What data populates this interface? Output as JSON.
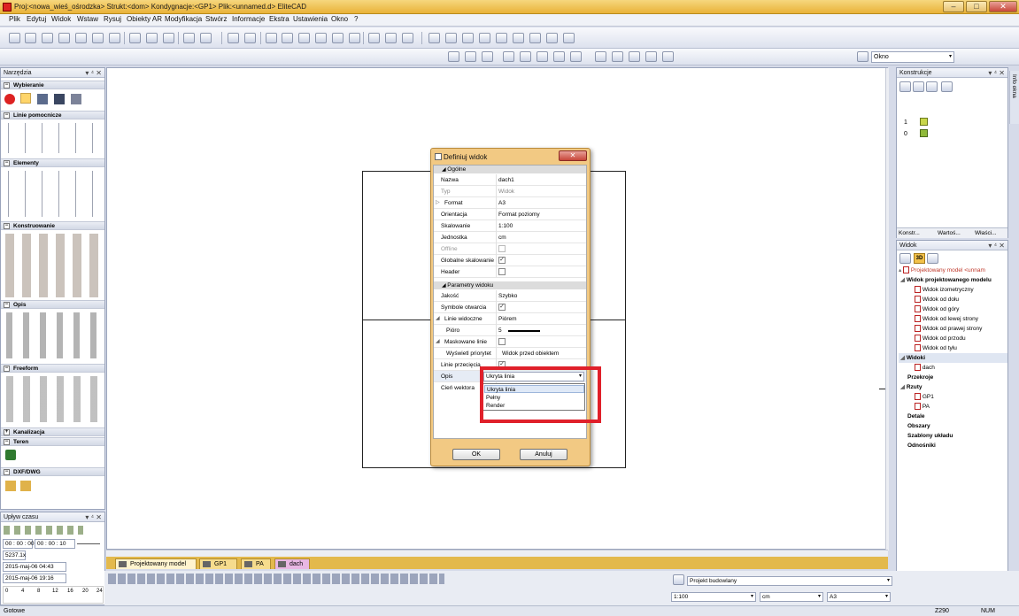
{
  "titlebar": {
    "title": "Proj:<nowa_wieś_ośrodzka> Strukt:<dom> Kondygnacje:<GP1> Plik:<unnamed.d> EliteCAD"
  },
  "menu": [
    "Plik",
    "Edytuj",
    "Widok",
    "Wstaw",
    "Rysuj",
    "Obiekty AR",
    "Modyfikacja",
    "Stwórz",
    "Informacje",
    "Ekstra",
    "Ustawienia",
    "Okno",
    "?"
  ],
  "window_combo": {
    "value": "Okno"
  },
  "tools_panel": {
    "title": "Narzędzia",
    "sections": [
      {
        "label": "Wybieranie"
      },
      {
        "label": "Linie pomocnicze"
      },
      {
        "label": "Elementy"
      },
      {
        "label": "Konstruowanie"
      },
      {
        "label": "Opis"
      },
      {
        "label": "Freeform"
      },
      {
        "label": "Kanalizacja"
      },
      {
        "label": "Teren"
      },
      {
        "label": "DXF/DWG"
      }
    ]
  },
  "time_panel": {
    "title": "Upływ czasu",
    "time_start": "00 : 00 : 00",
    "time_step": "00 : 00 : 10",
    "value": "5237.1x",
    "date1": "2015-maj-06 04:43",
    "date2": "2015-maj-06 19:16",
    "ticks": [
      "0",
      "4",
      "8",
      "12",
      "16",
      "20",
      "24"
    ]
  },
  "dialog": {
    "title": "Definiuj widok",
    "sections": [
      {
        "label": "Ogólne",
        "rows": [
          {
            "label": "Nazwa",
            "value": "dach1"
          },
          {
            "label": "Typ",
            "value": "Widok",
            "disabled": true
          },
          {
            "label": "Format",
            "value": "A3"
          },
          {
            "label": "Orientacja",
            "value": "Format poziomy"
          },
          {
            "label": "Skalowanie",
            "value": "1:100"
          },
          {
            "label": "Jednostka",
            "value": "cm"
          },
          {
            "label": "Offline",
            "value": "",
            "check": false,
            "disabled": true
          },
          {
            "label": "Globalne skalowanie",
            "value": "",
            "check": true
          },
          {
            "label": "Header",
            "value": "",
            "check": false
          }
        ]
      },
      {
        "label": "Parametry widoku",
        "rows": [
          {
            "label": "Jakość",
            "value": "Szybko"
          },
          {
            "label": "Symbole otwarcia",
            "value": "",
            "check": true
          },
          {
            "label": "Linie widoczne",
            "value": "Piórem"
          },
          {
            "label": "Pióro",
            "value": "5"
          },
          {
            "label": "Maskowane linie",
            "value": "",
            "check": false
          },
          {
            "label": "Wyświetl priorytet",
            "value": "Widok przed obiektem"
          },
          {
            "label": "Linie przecięcia",
            "value": "",
            "check": true
          },
          {
            "label": "Opis",
            "value": "Ukryta linia"
          },
          {
            "label": "Cień wektora",
            "value": ""
          }
        ]
      }
    ],
    "dropdown_options": [
      "Ukryta linia",
      "Pełny",
      "Render"
    ],
    "ok_label": "OK",
    "cancel_label": "Anuluj"
  },
  "konstrukcje_panel": {
    "title": "Konstrukcje",
    "levels": [
      "1",
      "0"
    ],
    "tabs": [
      "Konstr...",
      "Wartoś...",
      "Właści..."
    ]
  },
  "widok_panel": {
    "title": "Widok",
    "tree": [
      {
        "label": "Projektowany model <unnam",
        "level": 0,
        "accent": true
      },
      {
        "label": "Widok projektowanego modelu",
        "level": 0,
        "bold": true
      },
      {
        "label": "Widok izometryczny",
        "level": 2
      },
      {
        "label": "Widok od dołu",
        "level": 2
      },
      {
        "label": "Widok od góry",
        "level": 2
      },
      {
        "label": "Widok od lewej strony",
        "level": 2
      },
      {
        "label": "Widok od prawej strony",
        "level": 2
      },
      {
        "label": "Widok od przodu",
        "level": 2
      },
      {
        "label": "Widok od tyłu",
        "level": 2
      },
      {
        "label": "Widoki",
        "level": 0,
        "bold": true,
        "selected": true
      },
      {
        "label": "dach",
        "level": 1
      },
      {
        "label": "Przekroje",
        "level": 0,
        "bold": true
      },
      {
        "label": "Rzuty",
        "level": 0,
        "bold": true
      },
      {
        "label": "GP1",
        "level": 1
      },
      {
        "label": "PA",
        "level": 1
      },
      {
        "label": "Detale",
        "level": 0,
        "bold": true
      },
      {
        "label": "Obszary",
        "level": 0,
        "bold": true
      },
      {
        "label": "Szablony układu",
        "level": 0,
        "bold": true
      },
      {
        "label": "Odnośniki",
        "level": 0,
        "bold": true
      }
    ],
    "side_label": "Info okna"
  },
  "doc_tabs": [
    {
      "label": "Projektowany model",
      "active": true
    },
    {
      "label": "GP1"
    },
    {
      "label": "PA"
    },
    {
      "label": "dach"
    }
  ],
  "bottom": {
    "project_field": "Projekt budowlany",
    "scale": "1:100",
    "unit": "cm",
    "format": "A3"
  },
  "status": {
    "left": "Gotowe",
    "zoom": "Z290",
    "num": "NUM"
  }
}
